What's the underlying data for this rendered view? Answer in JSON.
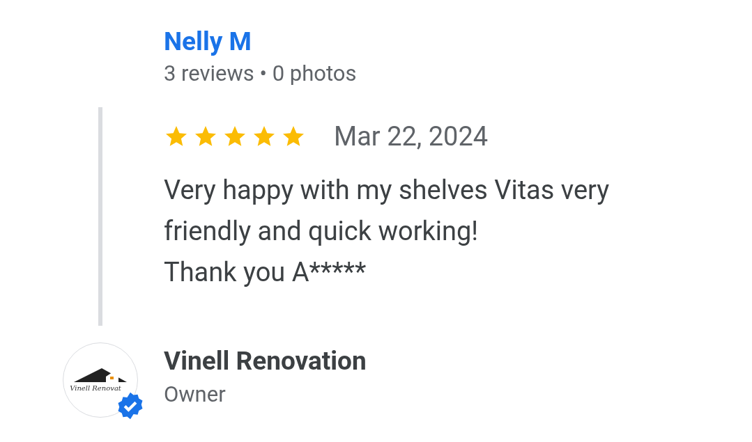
{
  "reviewer": {
    "name": "Nelly M",
    "meta": "3 reviews • 0 photos"
  },
  "review": {
    "stars": 5,
    "date": "Mar 22, 2024",
    "text_lines": [
      "Very happy with my shelves Vitas very",
      "friendly and quick working!",
      "Thank you A*****"
    ]
  },
  "owner_reply": {
    "logo_text": "Vinell Renovat",
    "verified": true,
    "name": "Vinell Renovation",
    "role": "Owner"
  }
}
